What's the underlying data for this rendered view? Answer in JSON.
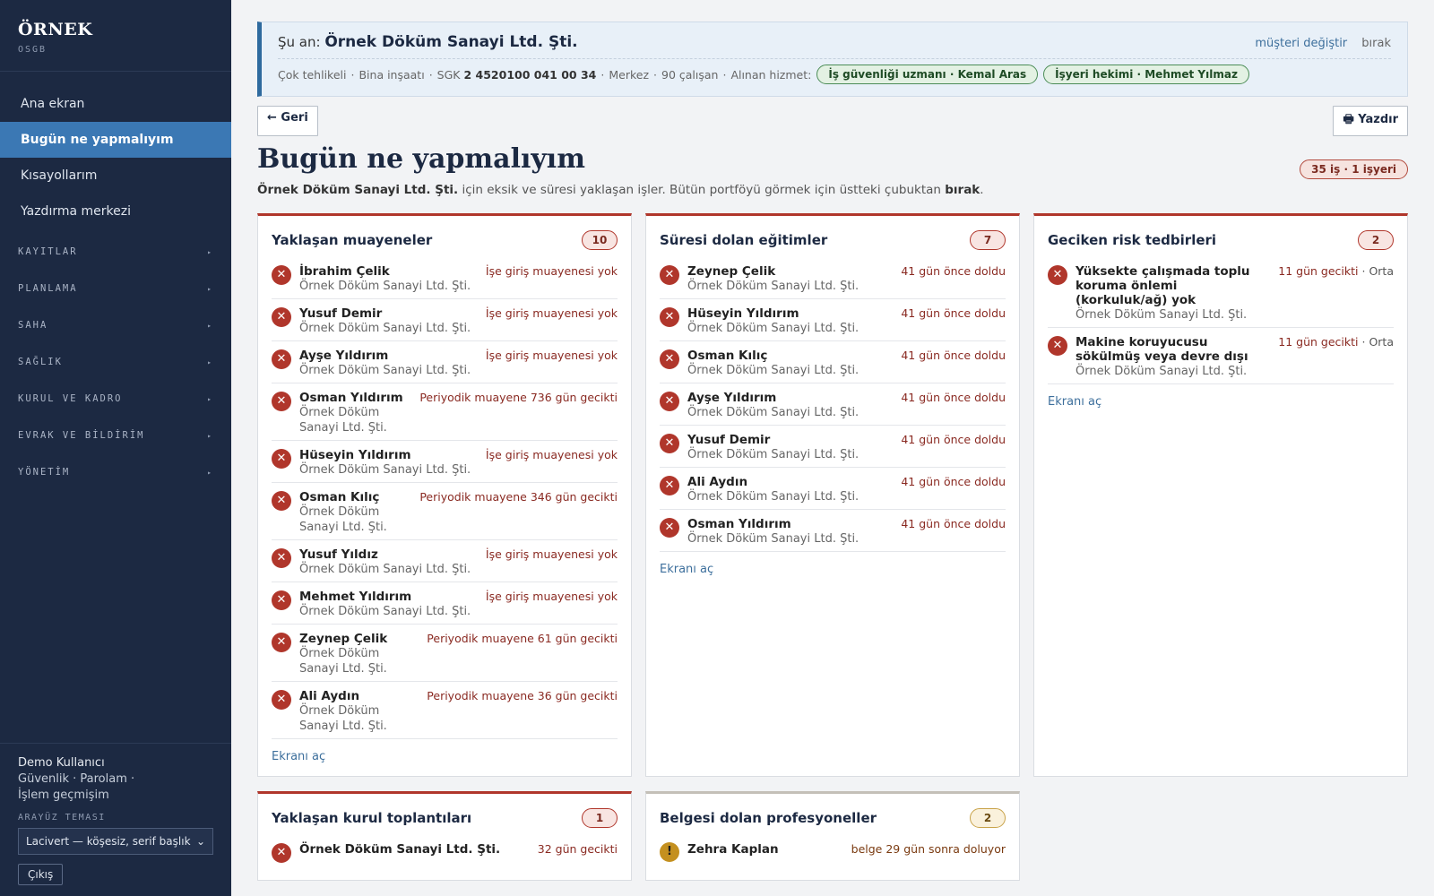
{
  "brand": {
    "name": "ÖRNEK",
    "sub": "OSGB"
  },
  "nav": {
    "items": [
      {
        "label": "Ana ekran"
      },
      {
        "label": "Bugün ne yapmalıyım"
      },
      {
        "label": "Kısayollarım"
      },
      {
        "label": "Yazdırma merkezi"
      }
    ],
    "groups": [
      {
        "label": "KAYITLAR"
      },
      {
        "label": "PLANLAMA"
      },
      {
        "label": "SAHA"
      },
      {
        "label": "SAĞLIK"
      },
      {
        "label": "KURUL VE KADRO"
      },
      {
        "label": "EVRAK VE BİLDİRİM"
      },
      {
        "label": "YÖNETİM"
      }
    ],
    "arrow": "▸"
  },
  "footer": {
    "user": "Demo Kullanıcı",
    "links": [
      "Güvenlik",
      "Parolam",
      "İşlem geçmişim"
    ],
    "theme_label": "ARAYÜZ TEMASI",
    "theme_value": "Lacivert — köşesiz, serif başlık",
    "logout": "Çıkış"
  },
  "context": {
    "prefix": "Şu an:",
    "company": "Örnek Döküm Sanayi Ltd. Şti.",
    "change": "müşteri değiştir",
    "leave": "bırak",
    "hazard": "Çok tehlikeli",
    "sector": "Bina inşaatı",
    "sgk_label": "SGK",
    "sgk": "2 4520100 041 00 34",
    "branch": "Merkez",
    "employees": "90 çalışan",
    "service_label": "Alınan hizmet:",
    "services": [
      "İş güvenliği uzmanı · Kemal Aras",
      "İşyeri hekimi · Mehmet Yılmaz"
    ]
  },
  "toolbar": {
    "back": "← Geri",
    "print": "🖶 Yazdır"
  },
  "page": {
    "title": "Bugün ne yapmalıyım",
    "badge": "35 iş · 1 işyeri",
    "subtitle_company": "Örnek Döküm Sanayi Ltd. Şti.",
    "subtitle_mid": " için eksik ve süresi yaklaşan işler. Bütün portföyü görmek için üstteki çubuktan ",
    "subtitle_bold": "bırak",
    "subtitle_end": "."
  },
  "cards": {
    "exams": {
      "title": "Yaklaşan muayeneler",
      "count": "10",
      "link": "Ekranı aç",
      "rows": [
        {
          "name": "İbrahim Çelik",
          "sub": "Örnek Döküm Sanayi Ltd. Şti.",
          "status": "İşe giriş muayenesi yok"
        },
        {
          "name": "Yusuf Demir",
          "sub": "Örnek Döküm Sanayi Ltd. Şti.",
          "status": "İşe giriş muayenesi yok"
        },
        {
          "name": "Ayşe Yıldırım",
          "sub": "Örnek Döküm Sanayi Ltd. Şti.",
          "status": "İşe giriş muayenesi yok"
        },
        {
          "name": "Osman Yıldırım",
          "sub": "Örnek Döküm Sanayi Ltd. Şti.",
          "status": "Periyodik muayene 736 gün gecikti"
        },
        {
          "name": "Hüseyin Yıldırım",
          "sub": "Örnek Döküm Sanayi Ltd. Şti.",
          "status": "İşe giriş muayenesi yok"
        },
        {
          "name": "Osman Kılıç",
          "sub": "Örnek Döküm Sanayi Ltd. Şti.",
          "status": "Periyodik muayene 346 gün gecikti"
        },
        {
          "name": "Yusuf Yıldız",
          "sub": "Örnek Döküm Sanayi Ltd. Şti.",
          "status": "İşe giriş muayenesi yok"
        },
        {
          "name": "Mehmet Yıldırım",
          "sub": "Örnek Döküm Sanayi Ltd. Şti.",
          "status": "İşe giriş muayenesi yok"
        },
        {
          "name": "Zeynep Çelik",
          "sub": "Örnek Döküm Sanayi Ltd. Şti.",
          "status": "Periyodik muayene 61 gün gecikti"
        },
        {
          "name": "Ali Aydın",
          "sub": "Örnek Döküm Sanayi Ltd. Şti.",
          "status": "Periyodik muayene 36 gün gecikti"
        }
      ]
    },
    "trainings": {
      "title": "Süresi dolan eğitimler",
      "count": "7",
      "link": "Ekranı aç",
      "rows": [
        {
          "name": "Zeynep Çelik",
          "sub": "Örnek Döküm Sanayi Ltd. Şti.",
          "status": "41 gün önce doldu"
        },
        {
          "name": "Hüseyin Yıldırım",
          "sub": "Örnek Döküm Sanayi Ltd. Şti.",
          "status": "41 gün önce doldu"
        },
        {
          "name": "Osman Kılıç",
          "sub": "Örnek Döküm Sanayi Ltd. Şti.",
          "status": "41 gün önce doldu"
        },
        {
          "name": "Ayşe Yıldırım",
          "sub": "Örnek Döküm Sanayi Ltd. Şti.",
          "status": "41 gün önce doldu"
        },
        {
          "name": "Yusuf Demir",
          "sub": "Örnek Döküm Sanayi Ltd. Şti.",
          "status": "41 gün önce doldu"
        },
        {
          "name": "Ali Aydın",
          "sub": "Örnek Döküm Sanayi Ltd. Şti.",
          "status": "41 gün önce doldu"
        },
        {
          "name": "Osman Yıldırım",
          "sub": "Örnek Döküm Sanayi Ltd. Şti.",
          "status": "41 gün önce doldu"
        }
      ]
    },
    "risks": {
      "title": "Geciken risk tedbirleri",
      "count": "2",
      "link": "Ekranı aç",
      "rows": [
        {
          "name": "Yüksekte çalışmada toplu koruma önlemi (korkuluk/ağ) yok",
          "sub": "Örnek Döküm Sanayi Ltd. Şti.",
          "status": "11 gün gecikti",
          "level": "Orta"
        },
        {
          "name": "Makine koruyucusu sökülmüş veya devre dışı",
          "sub": "Örnek Döküm Sanayi Ltd. Şti.",
          "status": "11 gün gecikti",
          "level": "Orta"
        }
      ]
    },
    "meetings": {
      "title": "Yaklaşan kurul toplantıları",
      "count": "1",
      "rows": [
        {
          "name": "Örnek Döküm Sanayi Ltd. Şti.",
          "status": "32 gün gecikti"
        }
      ]
    },
    "certs": {
      "title": "Belgesi dolan profesyoneller",
      "count": "2",
      "rows": [
        {
          "name": "Zehra Kaplan",
          "status": "belge 29 gün sonra doluyor"
        }
      ]
    }
  }
}
